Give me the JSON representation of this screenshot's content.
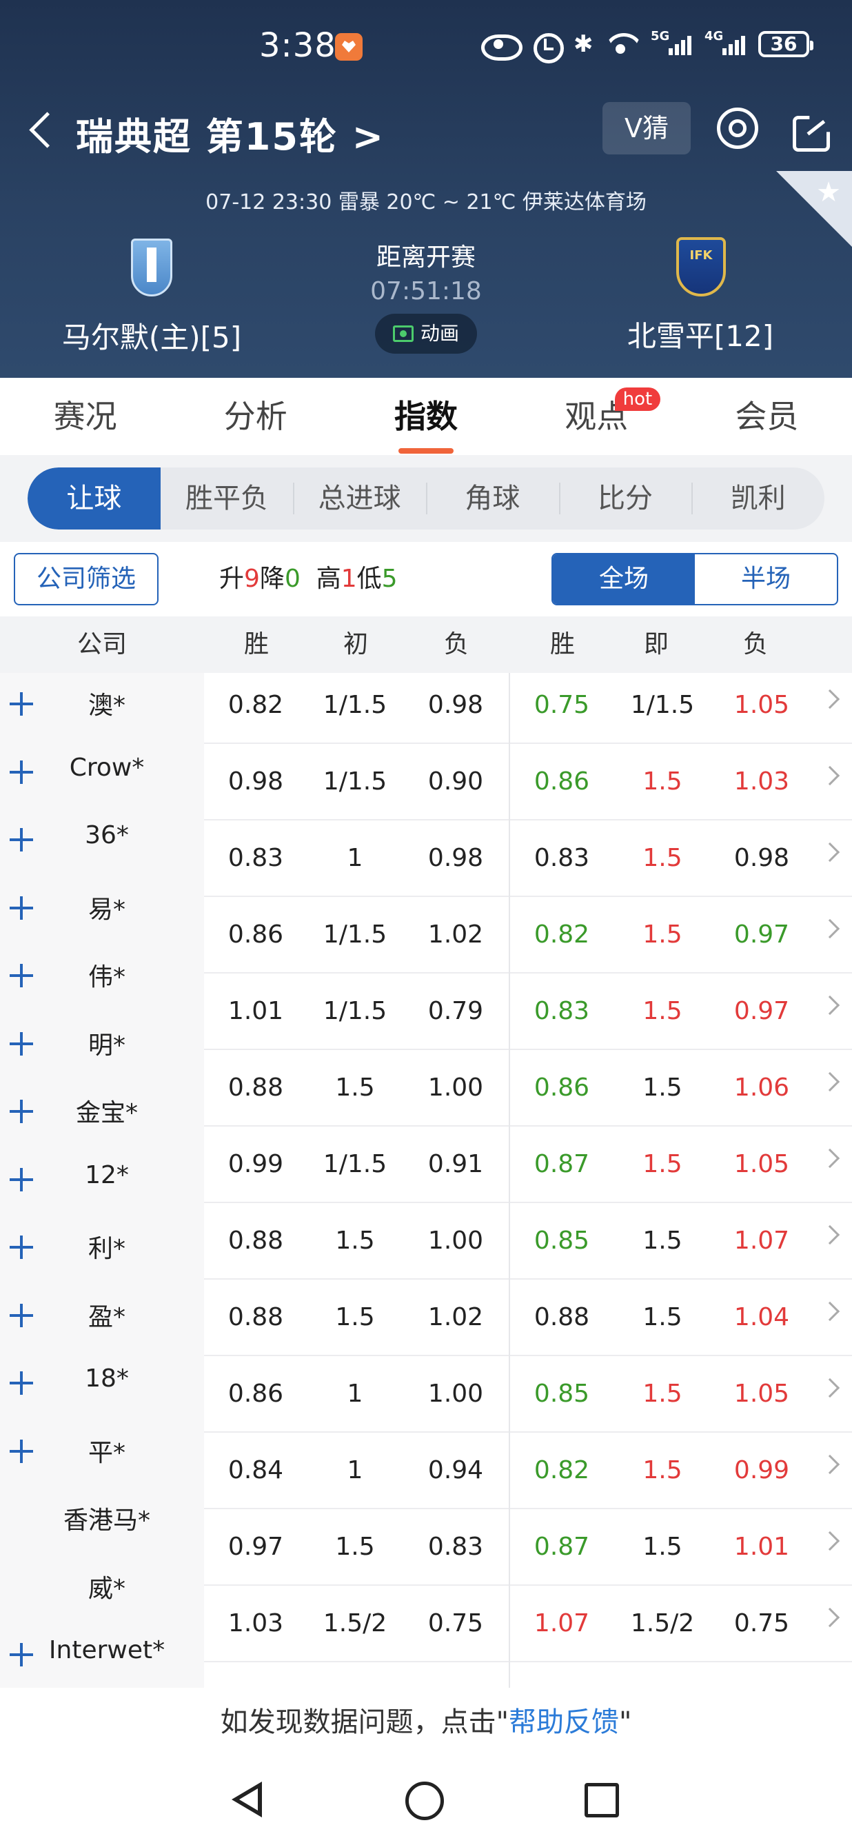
{
  "status": {
    "time": "3:38",
    "battery": "36",
    "signal1_label": "5G",
    "signal2_label": "4G"
  },
  "header": {
    "league": "瑞典超 第15轮 >",
    "vguess": "V猜",
    "match_info": "07-12 23:30   雷暴 20℃ ~ 21℃   伊莱达体育场",
    "home_team": "马尔默(主)[5]",
    "away_team": "北雪平[12]",
    "kickoff_label": "距离开赛",
    "countdown": "07:51:18",
    "animation_label": "动画"
  },
  "main_tabs": [
    {
      "label": "赛况",
      "active": false
    },
    {
      "label": "分析",
      "active": false
    },
    {
      "label": "指数",
      "active": true
    },
    {
      "label": "观点",
      "active": false,
      "badge": "hot"
    },
    {
      "label": "会员",
      "active": false
    }
  ],
  "sub_tabs": [
    {
      "label": "让球",
      "active": true
    },
    {
      "label": "胜平负"
    },
    {
      "label": "总进球"
    },
    {
      "label": "角球"
    },
    {
      "label": "比分"
    },
    {
      "label": "凯利"
    }
  ],
  "filter": {
    "company_filter": "公司筛选",
    "up_label": "升",
    "up_count": "9",
    "down_label": "降",
    "down_count": "0",
    "high_label": "高",
    "high_count": "1",
    "low_label": "低",
    "low_count": "5",
    "full_time": "全场",
    "half_time": "半场"
  },
  "table": {
    "headers": [
      "公司",
      "胜",
      "初",
      "负",
      "胜",
      "即",
      "负"
    ],
    "rows": [
      {
        "company": "澳*",
        "plus": true,
        "init": [
          "0.82",
          "1/1.5",
          "0.98"
        ],
        "live": [
          "0.75",
          "1/1.5",
          "1.05"
        ],
        "colors": [
          "green",
          "black",
          "red"
        ]
      },
      {
        "company": "Crow*",
        "plus": true,
        "init": [
          "0.98",
          "1/1.5",
          "0.90"
        ],
        "live": [
          "0.86",
          "1.5",
          "1.03"
        ],
        "colors": [
          "green",
          "red",
          "red"
        ]
      },
      {
        "company": "36*",
        "plus": true,
        "init": [
          "0.83",
          "1",
          "0.98"
        ],
        "live": [
          "0.83",
          "1.5",
          "0.98"
        ],
        "colors": [
          "black",
          "red",
          "black"
        ]
      },
      {
        "company": "易*",
        "plus": true,
        "init": [
          "0.86",
          "1/1.5",
          "1.02"
        ],
        "live": [
          "0.82",
          "1.5",
          "0.97"
        ],
        "colors": [
          "green",
          "red",
          "green"
        ]
      },
      {
        "company": "伟*",
        "plus": true,
        "init": [
          "1.01",
          "1/1.5",
          "0.79"
        ],
        "live": [
          "0.83",
          "1.5",
          "0.97"
        ],
        "colors": [
          "green",
          "red",
          "red"
        ]
      },
      {
        "company": "明*",
        "plus": true,
        "init": [
          "0.88",
          "1.5",
          "1.00"
        ],
        "live": [
          "0.86",
          "1.5",
          "1.06"
        ],
        "colors": [
          "green",
          "black",
          "red"
        ]
      },
      {
        "company": "金宝*",
        "plus": true,
        "init": [
          "0.99",
          "1/1.5",
          "0.91"
        ],
        "live": [
          "0.87",
          "1.5",
          "1.05"
        ],
        "colors": [
          "green",
          "red",
          "red"
        ]
      },
      {
        "company": "12*",
        "plus": true,
        "init": [
          "0.88",
          "1.5",
          "1.00"
        ],
        "live": [
          "0.85",
          "1.5",
          "1.07"
        ],
        "colors": [
          "green",
          "black",
          "red"
        ]
      },
      {
        "company": "利*",
        "plus": true,
        "init": [
          "0.88",
          "1.5",
          "1.02"
        ],
        "live": [
          "0.88",
          "1.5",
          "1.04"
        ],
        "colors": [
          "black",
          "black",
          "red"
        ]
      },
      {
        "company": "盈*",
        "plus": true,
        "init": [
          "0.86",
          "1",
          "1.00"
        ],
        "live": [
          "0.85",
          "1.5",
          "1.05"
        ],
        "colors": [
          "green",
          "red",
          "red"
        ]
      },
      {
        "company": "18*",
        "plus": true,
        "init": [
          "0.84",
          "1",
          "0.94"
        ],
        "live": [
          "0.82",
          "1.5",
          "0.99"
        ],
        "colors": [
          "green",
          "red",
          "red"
        ]
      },
      {
        "company": "平*",
        "plus": true,
        "init": [
          "0.97",
          "1.5",
          "0.83"
        ],
        "live": [
          "0.87",
          "1.5",
          "1.01"
        ],
        "colors": [
          "green",
          "black",
          "red"
        ]
      },
      {
        "company": "香港马*",
        "plus": false,
        "init": [
          "1.03",
          "1.5/2",
          "0.75"
        ],
        "live": [
          "1.07",
          "1.5/2",
          "0.75"
        ],
        "colors": [
          "red",
          "black",
          "black"
        ]
      },
      {
        "company": "威*",
        "plus": false
      },
      {
        "company": "Interwet*",
        "plus": true
      }
    ]
  },
  "footer": {
    "note_prefix": "如发现数据问题，点击\"",
    "help_link": "帮助反馈",
    "note_suffix": "\""
  }
}
